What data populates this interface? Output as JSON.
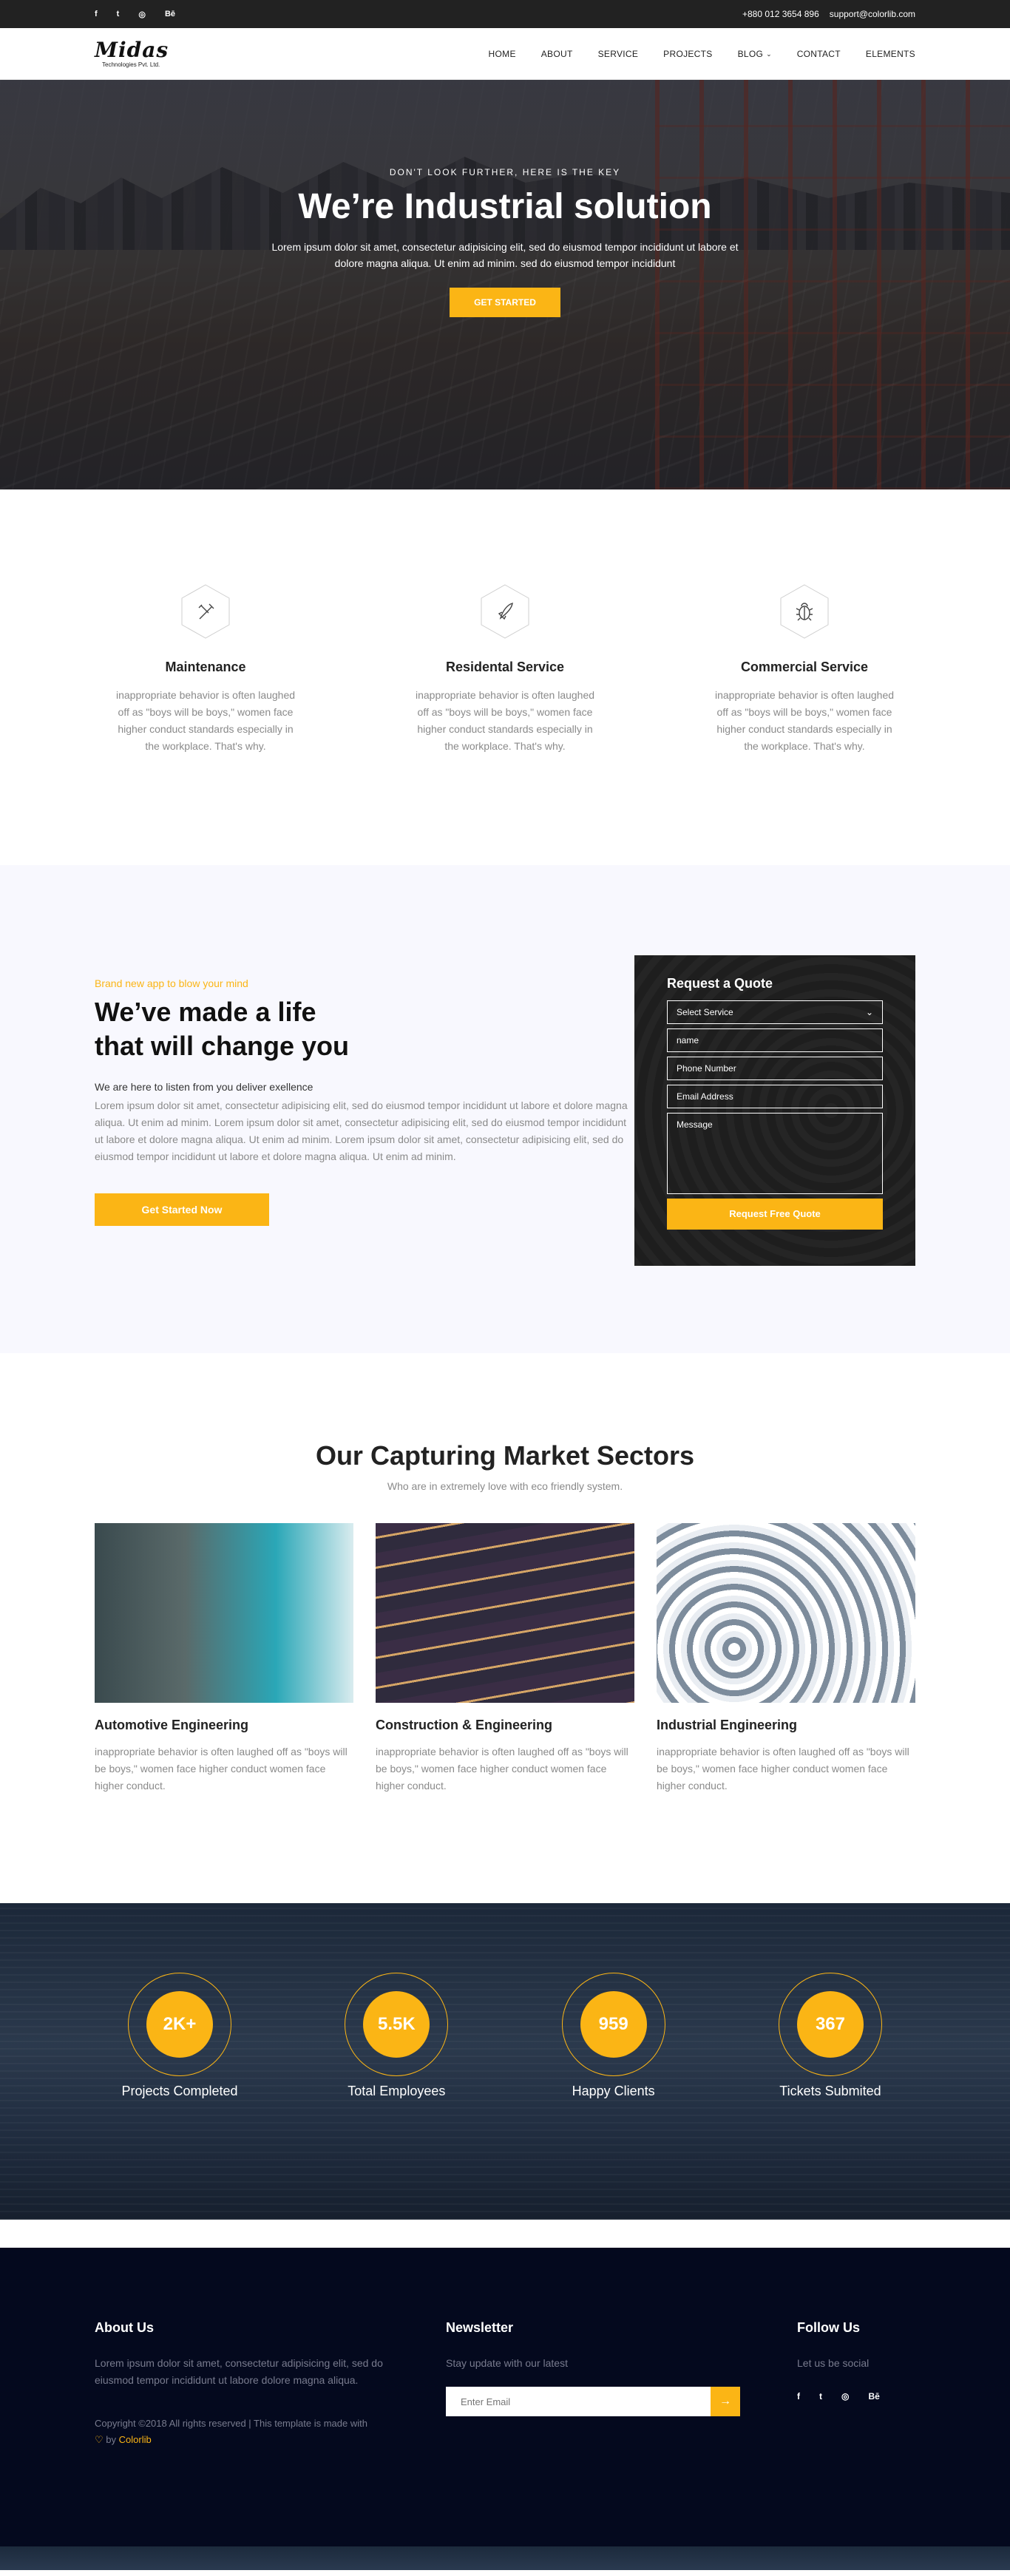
{
  "topbar": {
    "social": [
      "f",
      "t",
      "◎",
      "Bē"
    ],
    "phone": "+880 012 3654 896",
    "email": "support@colorlib.com"
  },
  "header": {
    "logo_brand": "Midas",
    "logo_tag": "Technologies Pvt. Ltd.",
    "nav": [
      {
        "label": "HOME"
      },
      {
        "label": "ABOUT"
      },
      {
        "label": "SERVICE"
      },
      {
        "label": "PROJECTS"
      },
      {
        "label": "BLOG"
      },
      {
        "label": "CONTACT"
      },
      {
        "label": "ELEMENTS"
      }
    ]
  },
  "hero": {
    "eyebrow": "DON'T LOOK FURTHER, HERE IS THE KEY",
    "title": "We’re Industrial solution",
    "text": "Lorem ipsum dolor sit amet, consectetur adipisicing elit, sed do eiusmod tempor incididunt ut labore et dolore magna aliqua. Ut enim ad minim. sed do eiusmod tempor incididunt",
    "cta": "GET STARTED"
  },
  "services": [
    {
      "title": "Maintenance",
      "icon": "tools-icon",
      "text": "inappropriate behavior is often laughed off as \"boys will be boys,\" women face higher conduct standards especially in the workplace. That's why."
    },
    {
      "title": "Residental Service",
      "icon": "rocket-icon",
      "text": "inappropriate behavior is often laughed off as \"boys will be boys,\" women face higher conduct standards especially in the workplace. That's why."
    },
    {
      "title": "Commercial Service",
      "icon": "bug-icon",
      "text": "inappropriate behavior is often laughed off as \"boys will be boys,\" women face higher conduct standards especially in the workplace. That's why."
    }
  ],
  "quote_section": {
    "eyebrow": "Brand new app to blow your mind",
    "title_line1": "We’ve made a life",
    "title_line2": "that will change you",
    "lead": "We are here to listen from you deliver exellence",
    "body": "Lorem ipsum dolor sit amet, consectetur adipisicing elit, sed do eiusmod tempor incididunt ut labore et dolore magna aliqua. Ut enim ad minim. Lorem ipsum dolor sit amet, consectetur adipisicing elit, sed do eiusmod tempor incididunt ut labore et dolore magna aliqua. Ut enim ad minim. Lorem ipsum dolor sit amet, consectetur adipisicing elit, sed do eiusmod tempor incididunt ut labore et dolore magna aliqua. Ut enim ad minim.",
    "cta": "Get Started Now",
    "form": {
      "title": "Request a Quote",
      "select": "Select Service",
      "name": "name",
      "phone": "Phone Number",
      "email": "Email Address",
      "message": "Message",
      "submit": "Request Free Quote"
    }
  },
  "sectors": {
    "title": "Our Capturing Market Sectors",
    "subtitle": "Who are in extremely love with eco friendly system.",
    "items": [
      {
        "title": "Automotive Engineering",
        "text": "inappropriate behavior is often laughed off as \"boys will be boys,\" women face higher conduct women face higher conduct."
      },
      {
        "title": "Construction & Engineering",
        "text": "inappropriate behavior is often laughed off as \"boys will be boys,\" women face higher conduct women face higher conduct."
      },
      {
        "title": "Industrial Engineering",
        "text": "inappropriate behavior is often laughed off as \"boys will be boys,\" women face higher conduct women face higher conduct."
      }
    ]
  },
  "stats": [
    {
      "value": "2K+",
      "label": "Projects Completed"
    },
    {
      "value": "5.5K",
      "label": "Total Employees"
    },
    {
      "value": "959",
      "label": "Happy Clients"
    },
    {
      "value": "367",
      "label": "Tickets Submited"
    }
  ],
  "footer": {
    "about_title": "About Us",
    "about_text": "Lorem ipsum dolor sit amet, consectetur adipisicing elit, sed do eiusmod tempor incididunt ut labore dolore magna aliqua.",
    "copy_text": "Copyright ©2018 All rights reserved | This template is made with",
    "copy_by": "by",
    "copy_link": "Colorlib",
    "news_title": "Newsletter",
    "news_text": "Stay update with our latest",
    "news_placeholder": "Enter Email",
    "follow_title": "Follow Us",
    "follow_text": "Let us be social",
    "social": [
      "f",
      "t",
      "◎",
      "Bē"
    ]
  },
  "colors": {
    "accent": "#fbb515",
    "footer_bg": "#04091e",
    "topbar_bg": "#222222"
  }
}
